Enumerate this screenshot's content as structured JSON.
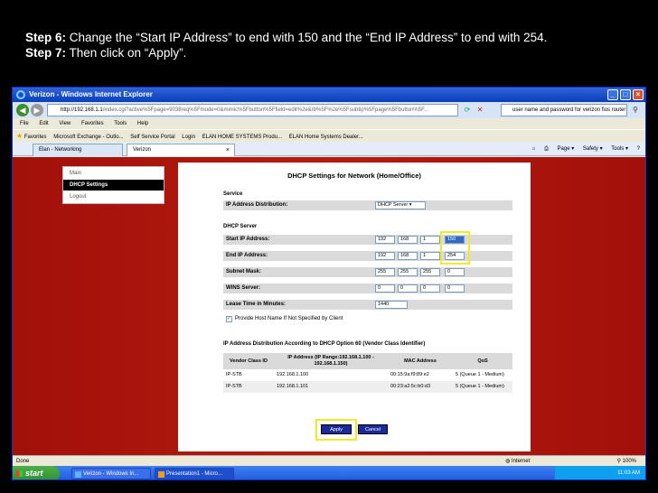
{
  "slide": {
    "step6_label": "Step 6:",
    "step6_text": " Change the “Start IP Address” to end with 150 and the “End IP Address” to end with 254.",
    "step7_label": "Step 7:",
    "step7_text": " Then click on “Apply”."
  },
  "browser": {
    "window_title": "Verizon - Windows Internet Explorer",
    "url_host": "http://192.168.1.1",
    "url_rest": "/index.cgi?active%5Fpage=9038req%5Fmode=0&mimic%5Fbutton%5Ffield=edit%2e&rb%5F%2e%5Fsubtip%5Fpage%5Fbutton%5F...",
    "search_text": "user name and password for verizon fios router",
    "menu": [
      "File",
      "Edit",
      "View",
      "Favorites",
      "Tools",
      "Help"
    ],
    "favorites_label": "Favorites",
    "favorites": [
      "Microsoft Exchange - Outlo...",
      "Self Service Portal",
      "Login",
      "ELAN HOME SYSTEMS Produ...",
      "ELAN Home Systems Dealer..."
    ],
    "tabs": [
      {
        "label": "Elan - Networking"
      },
      {
        "label": "Verizon"
      }
    ],
    "command_bar": [
      "Page ▾",
      "Safety ▾",
      "Tools ▾"
    ],
    "status_left": "Done",
    "status_zone": "Internet",
    "status_zoom": "100%"
  },
  "sidebar": {
    "items": [
      "Main",
      "DHCP Settings",
      "Logout"
    ]
  },
  "dhcp": {
    "title": "DHCP Settings for Network (Home/Office)",
    "service_head": "Service",
    "distribution_label": "IP Address Distribution:",
    "distribution_value": "DHCP Server",
    "server_head": "DHCP Server",
    "start_label": "Start IP Address:",
    "start_ip": [
      "192",
      "168",
      "1",
      "150"
    ],
    "end_label": "End IP Address:",
    "end_ip": [
      "192",
      "168",
      "1",
      "254"
    ],
    "mask_label": "Subnet Mask:",
    "mask": [
      "255",
      "255",
      "255",
      "0"
    ],
    "wins_label": "WINS Server:",
    "wins": [
      "0",
      "0",
      "0",
      "0"
    ],
    "lease_label": "Lease Time in Minutes:",
    "lease_value": "1440",
    "provide_host_label": "Provide Host Name If Not Specified by Client",
    "provide_host_checked": true,
    "option60_head": "IP Address Distribution According to DHCP Option 60 (Vendor Class Identifier)",
    "table_headers": [
      "Vendor Class ID",
      "IP Address (IP Range:192.168.1.100 - 192.168.1.150)",
      "MAC Address",
      "QoS"
    ],
    "table_rows": [
      [
        "IP-STB",
        "192.168.1.100",
        "00:15:9a:f9:89:e2",
        "5 (Queue 1 - Medium)"
      ],
      [
        "IP-STB",
        "192.168.1.101",
        "00:23:a2:5c:b0:d3",
        "5 (Queue 1 - Medium)"
      ]
    ],
    "apply_label": "Apply",
    "cancel_label": "Cancel"
  },
  "taskbar": {
    "start_label": "start",
    "tasks": [
      "Verizon - Windows In...",
      "Presentation1 - Micro..."
    ],
    "clock": "11:03 AM"
  },
  "colors": {
    "highlight": "#f4e82a",
    "router_bg": "#b51b0e",
    "button_blue": "#1b2a9a"
  }
}
